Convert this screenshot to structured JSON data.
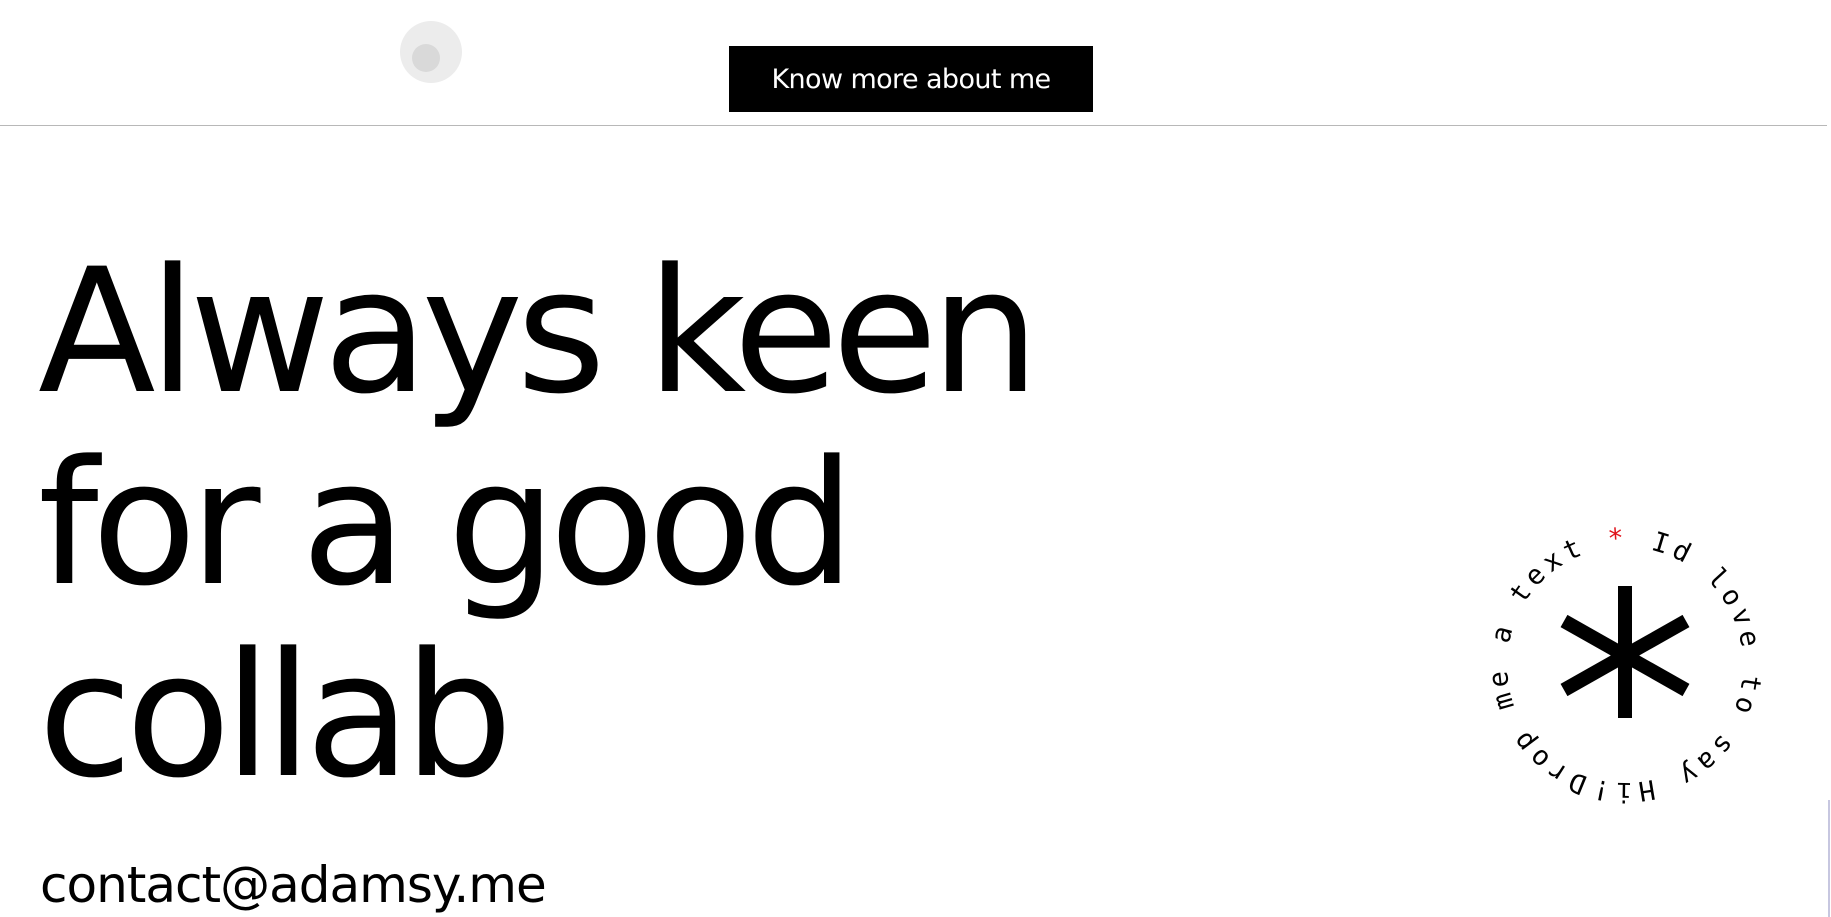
{
  "header": {
    "cta_label": "Know more about me"
  },
  "hero": {
    "headline_lines": [
      "Always keen",
      "for a good",
      "collab"
    ],
    "email": "contact@adamsy.me"
  },
  "badge": {
    "ring_text": "Drop me a text * Id love to say Hi! ",
    "center_icon": "asterisk-icon",
    "accent_color": "#e0131b"
  }
}
